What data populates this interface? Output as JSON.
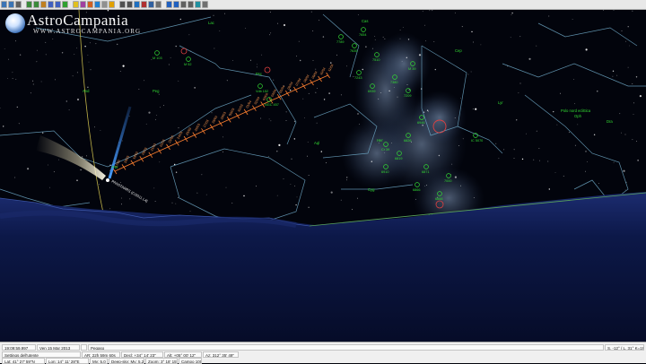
{
  "logo": {
    "title": "AstroCampania",
    "url": "WWW.ASTROCAMPANIA.ORG"
  },
  "toolbar": {
    "buttons": [
      {
        "icon": "open-icon",
        "color": "#3b74b5"
      },
      {
        "icon": "save-icon",
        "color": "#3b74b5"
      },
      {
        "icon": "print-icon",
        "color": "#606060"
      },
      {
        "icon": "zoom-in-icon",
        "color": "#3a8a3a"
      },
      {
        "icon": "zoom-out-icon",
        "color": "#3a8a3a"
      },
      {
        "icon": "find-icon",
        "color": "#c08020"
      },
      {
        "icon": "grid-icon",
        "color": "#4060c0"
      },
      {
        "icon": "constellation-icon",
        "color": "#4060c0"
      },
      {
        "icon": "horizon-icon",
        "color": "#30a030"
      },
      {
        "icon": "stars-icon",
        "color": "#e0c020"
      },
      {
        "icon": "deepsky-icon",
        "color": "#a040a0"
      },
      {
        "icon": "planet-icon",
        "color": "#d06020"
      },
      {
        "icon": "comet-icon",
        "color": "#2080d0"
      },
      {
        "icon": "moon-icon",
        "color": "#909090"
      },
      {
        "icon": "sun-icon",
        "color": "#e0a000"
      },
      {
        "icon": "time-back-icon",
        "color": "#505050"
      },
      {
        "icon": "time-forward-icon",
        "color": "#505050"
      },
      {
        "icon": "clock-icon",
        "color": "#2070c0"
      },
      {
        "icon": "chart-icon",
        "color": "#b03030"
      },
      {
        "icon": "telescope-icon",
        "color": "#3060a0"
      },
      {
        "icon": "settings-icon",
        "color": "#707070"
      },
      {
        "icon": "info-icon",
        "color": "#2060c0"
      },
      {
        "icon": "help-icon",
        "color": "#2060c0"
      },
      {
        "icon": "undo-icon",
        "color": "#606060"
      },
      {
        "icon": "redo-icon",
        "color": "#606060"
      },
      {
        "icon": "refresh-icon",
        "color": "#2090a0"
      },
      {
        "icon": "fullscreen-icon",
        "color": "#707070"
      }
    ]
  },
  "sky": {
    "colors": {
      "sky": "#02040c",
      "constellation": "#6fa9c7",
      "horizon": "#5aa35a",
      "ground": "#0a1540",
      "milky_way": "#8fa8c8",
      "labels": "#33dd33",
      "comet_trail": "#ff8030",
      "red": "#e04040"
    },
    "labels": [
      "Cas",
      "Per",
      "Cep",
      "Lac",
      "Cyg",
      "Dra",
      "And",
      "Peg",
      "Oph",
      "Psc",
      "Her",
      "Lyr",
      "Aql",
      "Polo nord eclittica"
    ],
    "dso_labels": [
      "7789",
      "7654",
      "7635",
      "7510",
      "7380",
      "7209",
      "7243",
      "6939",
      "6946",
      "6826",
      "6819",
      "6910",
      "6871",
      "6866",
      "6888",
      "7000",
      "IC 5070",
      "M 39",
      "M 52",
      "M 103",
      "NGC 457",
      "Vdb 152",
      "Cr 39",
      "Barnard 21"
    ],
    "comet_name": "PANSTARRS (C/2011 L4)",
    "comet_dates": [
      "17/03",
      "18/03",
      "19/03",
      "20/03",
      "21/03",
      "22/03",
      "23/03",
      "24/03",
      "25/03",
      "26/03",
      "27/03",
      "28/03",
      "29/03",
      "30/03",
      "31/03",
      "01/04",
      "02/04",
      "03/04",
      "04/04",
      "05/04",
      "06/04",
      "07/04",
      "08/04",
      "09/04",
      "10/04",
      "11/04"
    ]
  },
  "status": {
    "time": "19:09:59.997",
    "date": "Ven 15 Mar 2013",
    "object": "Pegaso",
    "cursor": "S. -12° / L. 31° K=191",
    "location_name": "Settings dell'utente",
    "ar": "AR: 22h 59m 60s",
    "dec": "Decl: +34° 14' 23\"",
    "alt": "Alt: +05° 00' 12\"",
    "az": "Az: 312° 35' 49\"",
    "lat": "Lat: 41° 27' 59\"N",
    "lon": "Lon: 14° 11' 28\"E",
    "mag": "Mv: 5.0",
    "deep": "Deep-sky: Mv: 5.2",
    "zoom": "Zoom: 3° 18' 15\"",
    "fov": "Campo 100°"
  }
}
